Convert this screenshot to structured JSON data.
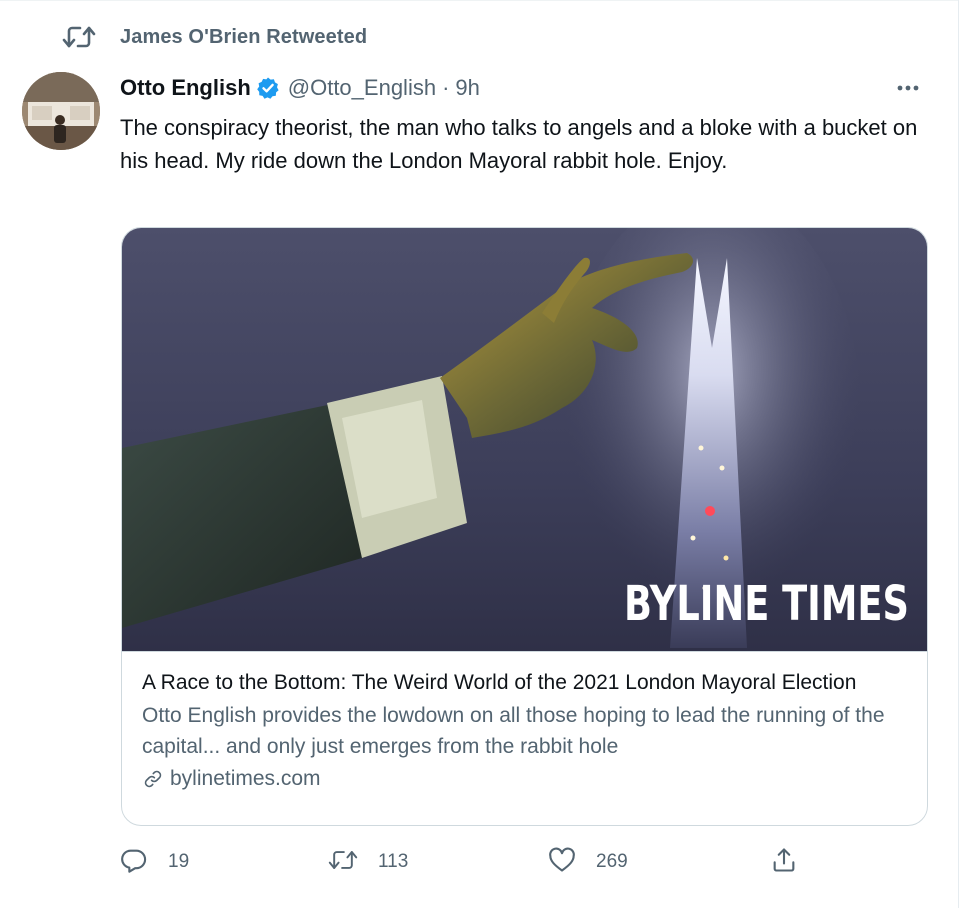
{
  "retweet_header": {
    "text": "James O'Brien Retweeted",
    "icon": "retweet-icon"
  },
  "tweet": {
    "author_name": "Otto English",
    "handle": "@Otto_English",
    "separator": "·",
    "time": "9h",
    "verified": true,
    "text": "The conspiracy theorist, the man who talks to angels and a bloke with a bucket on his head. My ride down the London Mayoral rabbit hole. Enjoy."
  },
  "card": {
    "image_logo": "BYLINE TIMES",
    "title": "A Race to the Bottom: The Weird World of the 2021 London Mayoral Election",
    "description": "Otto English provides the lowdown on all those hoping to lead the running of the capital... and only just emerges from the rabbit hole",
    "domain": "bylinetimes.com"
  },
  "actions": {
    "reply_count": "19",
    "retweet_count": "113",
    "like_count": "269"
  },
  "colors": {
    "accent": "#1d9bf0",
    "secondary_text": "#536471",
    "primary_text": "#0f1419",
    "border": "#cfd9de"
  }
}
